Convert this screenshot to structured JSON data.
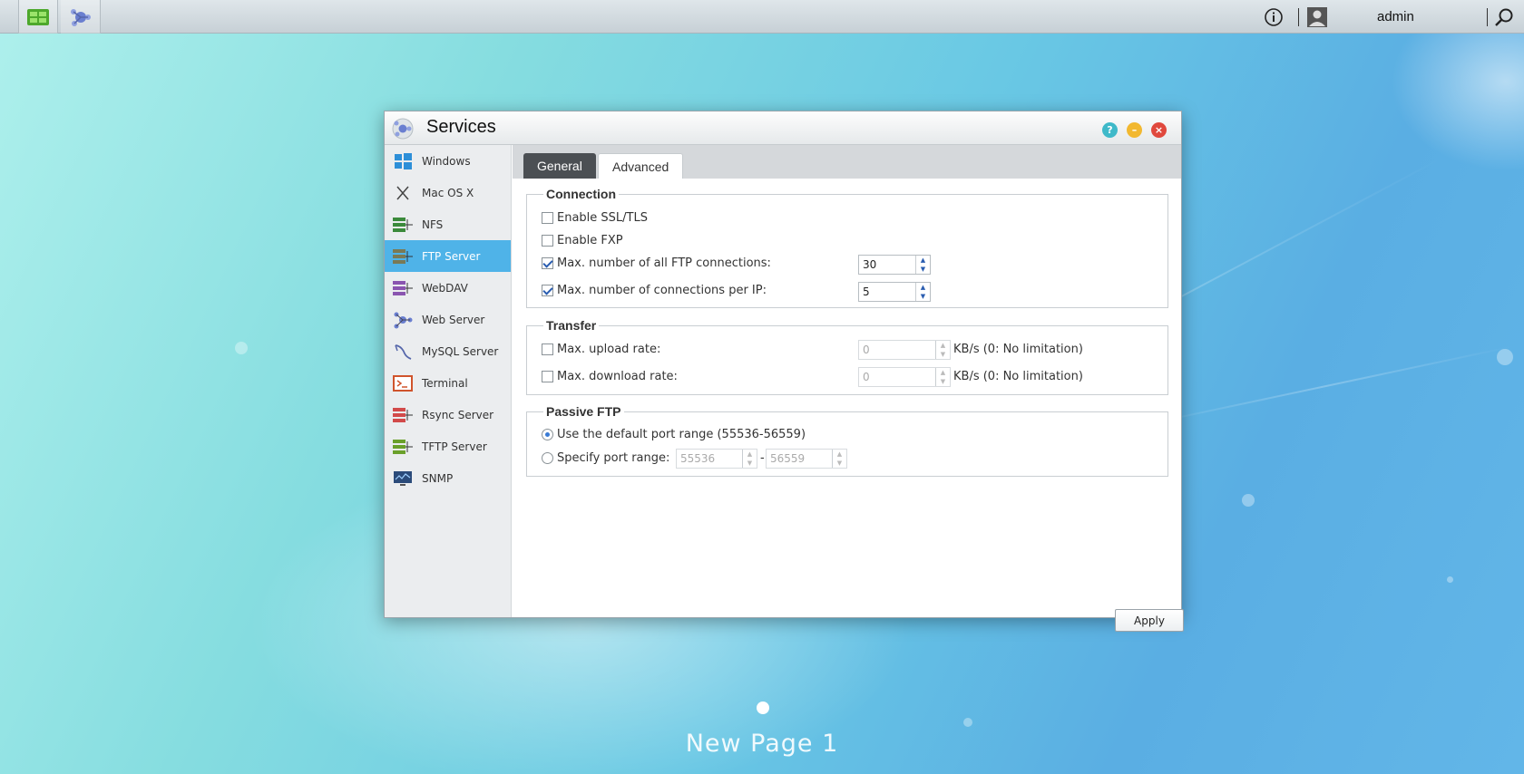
{
  "topbar": {
    "username": "admin"
  },
  "window": {
    "title": "Services",
    "sidebar": {
      "items": [
        {
          "label": "Windows",
          "icon": "windows-icon"
        },
        {
          "label": "Mac OS X",
          "icon": "macos-icon"
        },
        {
          "label": "NFS",
          "icon": "nfs-icon"
        },
        {
          "label": "FTP Server",
          "icon": "ftp-server-icon",
          "active": true
        },
        {
          "label": "WebDAV",
          "icon": "webdav-icon"
        },
        {
          "label": "Web Server",
          "icon": "web-server-icon"
        },
        {
          "label": "MySQL Server",
          "icon": "mysql-icon"
        },
        {
          "label": "Terminal",
          "icon": "terminal-icon"
        },
        {
          "label": "Rsync Server",
          "icon": "rsync-icon"
        },
        {
          "label": "TFTP Server",
          "icon": "tftp-icon"
        },
        {
          "label": "SNMP",
          "icon": "snmp-icon"
        }
      ]
    },
    "tabs": [
      {
        "label": "General"
      },
      {
        "label": "Advanced",
        "selected": true
      }
    ],
    "connection": {
      "title": "Connection",
      "ssl_label": "Enable SSL/TLS",
      "ssl_checked": false,
      "fxp_label": "Enable FXP",
      "fxp_checked": false,
      "max_all_label": "Max. number of all FTP connections:",
      "max_all_checked": true,
      "max_all_value": "30",
      "max_per_ip_label": "Max. number of connections per IP:",
      "max_per_ip_checked": true,
      "max_per_ip_value": "5"
    },
    "transfer": {
      "title": "Transfer",
      "upload_label": "Max. upload rate:",
      "upload_checked": false,
      "upload_value": "0",
      "upload_unit": "KB/s (0: No limitation)",
      "download_label": "Max. download rate:",
      "download_checked": false,
      "download_value": "0",
      "download_unit": "KB/s (0: No limitation)"
    },
    "passive": {
      "title": "Passive FTP",
      "default_label": "Use the default port range (55536-56559)",
      "specify_label": "Specify port range:",
      "selected": "default",
      "port_from": "55536",
      "port_to": "56559",
      "dash": "-"
    },
    "apply_label": "Apply"
  },
  "desktop": {
    "page_label": "New Page 1"
  }
}
